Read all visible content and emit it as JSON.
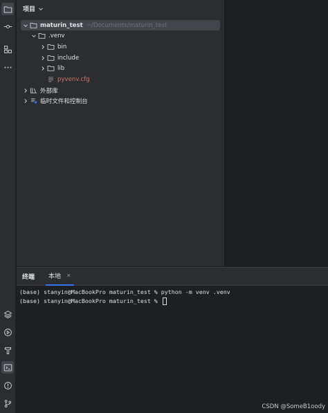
{
  "project_panel": {
    "title": "项目",
    "tree": [
      {
        "label": "maturin_test",
        "path": "~/Documents/maturin_test",
        "expanded": true,
        "type": "folder"
      },
      {
        "label": ".venv",
        "expanded": true,
        "type": "folder"
      },
      {
        "label": "bin",
        "expanded": false,
        "type": "folder"
      },
      {
        "label": "include",
        "expanded": false,
        "type": "folder"
      },
      {
        "label": "lib",
        "expanded": false,
        "type": "folder"
      },
      {
        "label": "pyvenv.cfg",
        "type": "file"
      },
      {
        "label": "外部库",
        "expanded": false,
        "type": "library"
      },
      {
        "label": "临时文件和控制台",
        "expanded": false,
        "type": "scratch"
      }
    ]
  },
  "terminal": {
    "title": "终端",
    "tab_label": "本地",
    "lines": [
      "(base) stanyin@MacBookPro maturin_test % python -m venv .venv",
      "(base) stanyin@MacBookPro maturin_test % "
    ]
  },
  "watermark": "CSDN @SomeB1oody",
  "colors": {
    "background": "#1e1f22",
    "panel": "#2b2d30",
    "selection": "#43454a",
    "accent": "#3574f0",
    "cfg_file": "#c77b6d"
  },
  "icons": {
    "activity_bar": [
      "folder-icon",
      "commit-icon",
      "structure-icon",
      "more-icon",
      "layers-icon",
      "run-icon",
      "build-icon",
      "terminal-icon",
      "problems-icon",
      "git-branch-icon"
    ]
  }
}
